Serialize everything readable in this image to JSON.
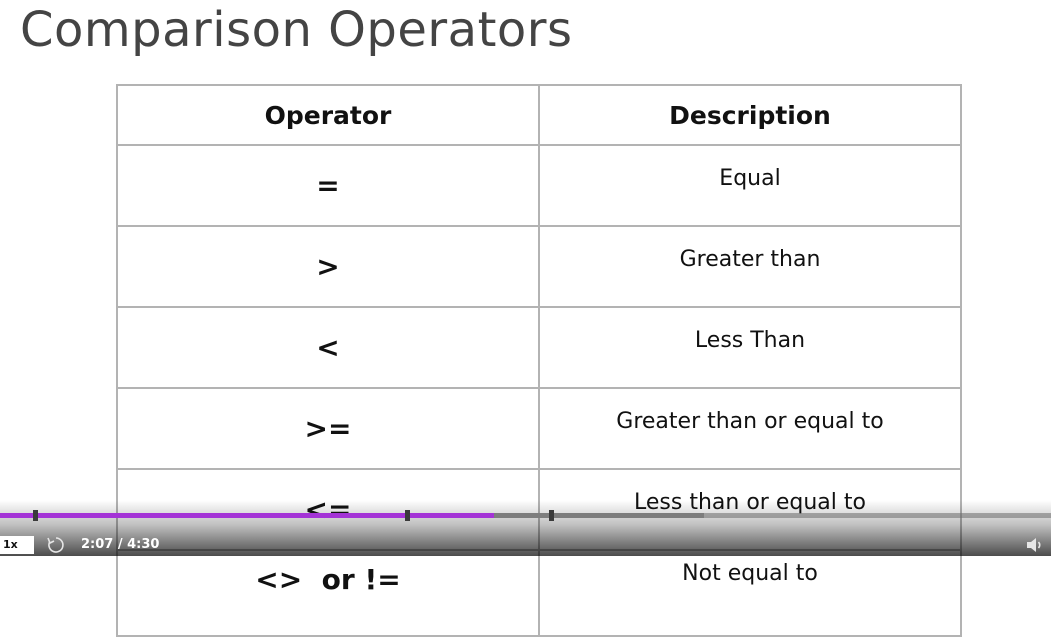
{
  "slide": {
    "title": "Comparison Operators",
    "table": {
      "headers": [
        "Operator",
        "Description"
      ],
      "rows": [
        {
          "operator": "=",
          "description": "Equal"
        },
        {
          "operator": ">",
          "description": "Greater than"
        },
        {
          "operator": "<",
          "description": "Less Than"
        },
        {
          "operator": ">=",
          "description": "Greater than or equal to"
        },
        {
          "operator": "<=",
          "description": "Less than or equal to"
        },
        {
          "operator": "<>  or !=",
          "description": "Not equal to"
        }
      ]
    }
  },
  "player": {
    "speed_label": "1x",
    "time_text": "2:07 / 4:30",
    "progress_fraction": 0.4704,
    "buffered_fraction": 0.67,
    "accent_color": "#a433d6",
    "icons": {
      "replay": "replay-icon",
      "volume": "volume-icon"
    }
  }
}
